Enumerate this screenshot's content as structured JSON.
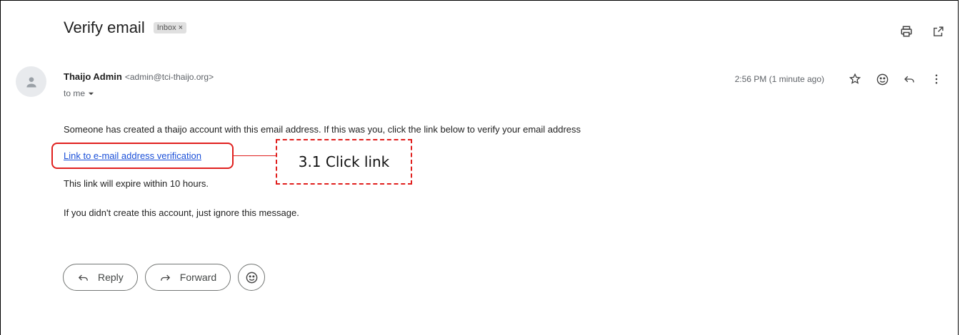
{
  "email": {
    "subject": "Verify email",
    "label": "Inbox",
    "label_close": "×",
    "sender_name": "Thaijo Admin",
    "sender_email": "<admin@tci-thaijo.org>",
    "recipient": "to me",
    "timestamp": "2:56 PM (1 minute ago)",
    "body": {
      "line1": "Someone has created a thaijo account with this email address. If this was you, click the link below to verify your email address",
      "link_text": "Link to e-mail address verification",
      "line2": "This link will expire within 10 hours.",
      "line3": "If you didn't create this account, just ignore this message."
    }
  },
  "actions": {
    "reply": "Reply",
    "forward": "Forward"
  },
  "annotation": {
    "callout_text": "3.1 Click link",
    "color": "#e0201e"
  },
  "icons": {
    "print": "print-icon",
    "open_new": "open-in-new-icon",
    "star": "star-icon",
    "emoji": "emoji-icon",
    "reply": "reply-icon",
    "more": "more-vert-icon",
    "forward": "forward-icon",
    "avatar": "person-icon",
    "dropdown": "caret-down-icon"
  }
}
